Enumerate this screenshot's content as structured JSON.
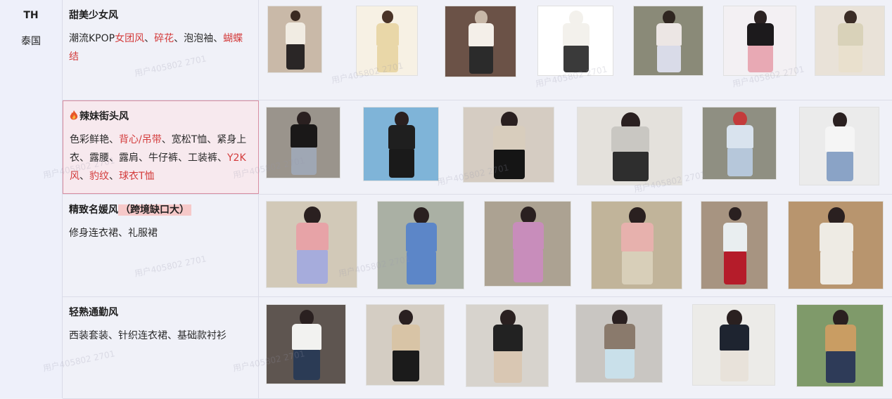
{
  "country": {
    "code": "TH",
    "name": "泰国"
  },
  "rows": [
    {
      "title": "甜美少女风",
      "desc": [
        {
          "t": "潮流KPOP",
          "hl": false
        },
        {
          "t": "女团风",
          "hl": true
        },
        {
          "t": "、",
          "hl": false
        },
        {
          "t": "碎花",
          "hl": true
        },
        {
          "t": "、泡泡袖、",
          "hl": false
        },
        {
          "t": "蝴蝶结",
          "hl": true
        }
      ],
      "photos": [
        {
          "bg": "#c9b9a8",
          "top": "#f1ece3",
          "bottom": "#2a2626",
          "hair": "#3a2a22"
        },
        {
          "bg": "#f7f1e4",
          "top": "#e9d7a8",
          "bottom": "#e9d7a8",
          "hair": "#4a3428"
        },
        {
          "bg": "#6b5247",
          "top": "#f4efe9",
          "bottom": "#2b2b2b",
          "hair": "#c8b8a8"
        },
        {
          "bg": "#ffffff",
          "top": "#f3f1ec",
          "bottom": "#3a3a3a",
          "hair": "#f3f1ec"
        },
        {
          "bg": "#8a8a78",
          "top": "#ece6e4",
          "bottom": "#d9dbe8",
          "hair": "#2f2620"
        },
        {
          "bg": "#f3f0f3",
          "top": "#1c1a1c",
          "bottom": "#e8a9b4",
          "hair": "#2b2222"
        },
        {
          "bg": "#e9e2d8",
          "top": "#d9d2b9",
          "bottom": "#e9e0cd",
          "hair": "#3b2d26"
        }
      ]
    },
    {
      "title": "辣妹街头风",
      "desc": [
        {
          "t": "色彩鲜艳、",
          "hl": false
        },
        {
          "t": "背心/吊带",
          "hl": true
        },
        {
          "t": "、宽松T恤、紧身上衣、露腰、露肩、牛仔裤、工装裤、",
          "hl": false
        },
        {
          "t": "Y2K风",
          "hl": true
        },
        {
          "t": "、",
          "hl": false
        },
        {
          "t": "豹纹",
          "hl": true
        },
        {
          "t": "、",
          "hl": false
        },
        {
          "t": "球衣T恤",
          "hl": true
        }
      ],
      "photos": [
        {
          "bg": "#9a948c",
          "top": "#1a1818",
          "bottom": "#9fa7b4",
          "hair": "#2a2020"
        },
        {
          "bg": "#7fb4d8",
          "top": "#1f1f1f",
          "bottom": "#1a1a1a",
          "hair": "#2a2020"
        },
        {
          "bg": "#d5ccc2",
          "top": "#d8cdbd",
          "bottom": "#151515",
          "hair": "#2a2020"
        },
        {
          "bg": "#e4e1dc",
          "top": "#c9c7c2",
          "bottom": "#2e2e2e",
          "hair": "#2a2020"
        },
        {
          "bg": "#8f8f82",
          "top": "#d9e3ee",
          "bottom": "#b6c7da",
          "hair": "#c33b3b"
        },
        {
          "bg": "#ebebeb",
          "top": "#f5f5f5",
          "bottom": "#8aa3c6",
          "hair": "#2a2020"
        }
      ]
    },
    {
      "title": "精致名媛风",
      "tag": "（跨境缺口大）",
      "desc": [
        {
          "t": "修身连衣裙、礼服裙",
          "hl": false
        }
      ],
      "photos": [
        {
          "bg": "#d2c9b8",
          "top": "#e7a3a7",
          "bottom": "#a6acdc",
          "hair": "#2a2020"
        },
        {
          "bg": "#aab0a4",
          "top": "#5c86c8",
          "bottom": "#5c86c8",
          "hair": "#2a2020"
        },
        {
          "bg": "#aca292",
          "top": "#c88dbb",
          "bottom": "#c88dbb",
          "hair": "#2a2020"
        },
        {
          "bg": "#c1b49a",
          "top": "#e7b1ad",
          "bottom": "#d8cfb9",
          "hair": "#2a2020"
        },
        {
          "bg": "#a79481",
          "top": "#e9eef0",
          "bottom": "#b51c2a",
          "hair": "#2a2020"
        },
        {
          "bg": "#b8956e",
          "top": "#eeebe4",
          "bottom": "#eeebe4",
          "hair": "#2a2020"
        }
      ]
    },
    {
      "title": "轻熟通勤风",
      "desc": [
        {
          "t": "西装套装、针织连衣裙、基础款衬衫",
          "hl": false
        }
      ],
      "photos": [
        {
          "bg": "#5e5550",
          "top": "#f2f2f0",
          "bottom": "#2b3b55",
          "hair": "#2a2020"
        },
        {
          "bg": "#d4cdc3",
          "top": "#d8c4a6",
          "bottom": "#1b1b1b",
          "hair": "#2a2020"
        },
        {
          "bg": "#d7d3cd",
          "top": "#222222",
          "bottom": "#d9c7b3",
          "hair": "#2a2020"
        },
        {
          "bg": "#c9c6c2",
          "top": "#8a7a6c",
          "bottom": "#c9e0ea",
          "hair": "#2a2020"
        },
        {
          "bg": "#ecebe8",
          "top": "#1e2430",
          "bottom": "#e8e2da",
          "hair": "#2a2020"
        },
        {
          "bg": "#7f9a6a",
          "top": "#c99d63",
          "bottom": "#2e3b58",
          "hair": "#2a2020"
        }
      ]
    }
  ],
  "watermark": "用户405802 2701"
}
